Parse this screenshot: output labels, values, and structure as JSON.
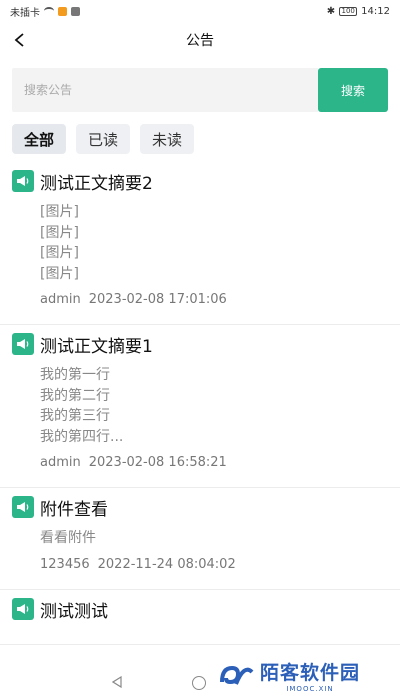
{
  "status_bar": {
    "carrier": "未插卡",
    "time": "14:12",
    "battery": "100"
  },
  "header": {
    "title": "公告"
  },
  "search": {
    "placeholder": "搜索公告",
    "value": "",
    "button_label": "搜索"
  },
  "filters": [
    {
      "label": "全部",
      "active": true
    },
    {
      "label": "已读",
      "active": false
    },
    {
      "label": "未读",
      "active": false
    }
  ],
  "announcements": [
    {
      "title": "测试正文摘要2",
      "lines": [
        "[图片]",
        "[图片]",
        "[图片]",
        "[图片]"
      ],
      "author": "admin",
      "datetime": "2023-02-08 17:01:06"
    },
    {
      "title": "测试正文摘要1",
      "lines": [
        "我的第一行",
        "我的第二行",
        "我的第三行",
        "我的第四行..."
      ],
      "author": "admin",
      "datetime": "2023-02-08 16:58:21"
    },
    {
      "title": "附件查看",
      "lines": [
        "看看附件"
      ],
      "author": "123456",
      "datetime": "2022-11-24 08:04:02"
    },
    {
      "title": "测试测试",
      "lines": [],
      "author": "",
      "datetime": ""
    }
  ],
  "watermark": {
    "name": "陌客软件园",
    "url": "IMOOC.XIN"
  },
  "colors": {
    "accent": "#2bb589",
    "watermark": "#2b5fb8"
  },
  "icons": {
    "item": "megaphone-icon",
    "back": "chevron-left-icon"
  }
}
